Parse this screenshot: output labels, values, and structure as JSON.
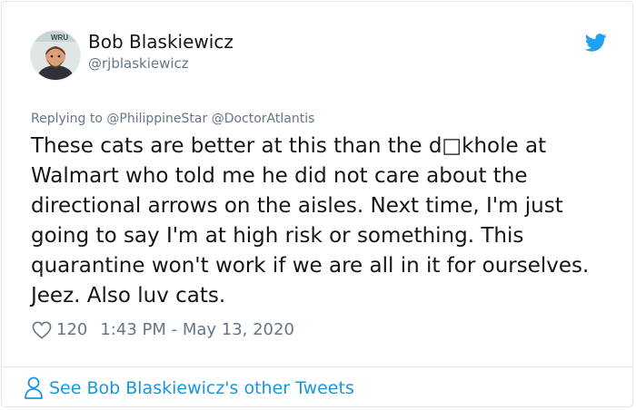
{
  "author": {
    "name": "Bob Blaskiewicz",
    "handle": "@rjblaskiewicz",
    "avatar_icon": "person-avatar",
    "avatar_banner_text": "WRU"
  },
  "brand": {
    "icon": "twitter-bird-icon",
    "color": "#1da1f2"
  },
  "reply": {
    "prefix": "Replying to ",
    "mentions": [
      "@PhilippineStar",
      "@DoctorAtlantis"
    ]
  },
  "tweet": {
    "text": "These cats are better at this than the d□khole at Walmart who told me he did not care about the directional arrows on the aisles. Next time, I'm just going to say I'm at high risk or something. This quarantine won't work if we are all in it for ourselves. Jeez. Also luv cats."
  },
  "meta": {
    "like_icon": "heart-outline-icon",
    "likes": "120",
    "timestamp": "1:43 PM - May 13, 2020"
  },
  "footer": {
    "icon": "person-outline-icon",
    "link_text": "See Bob Blaskiewicz's other Tweets",
    "color": "#1b95e0"
  }
}
